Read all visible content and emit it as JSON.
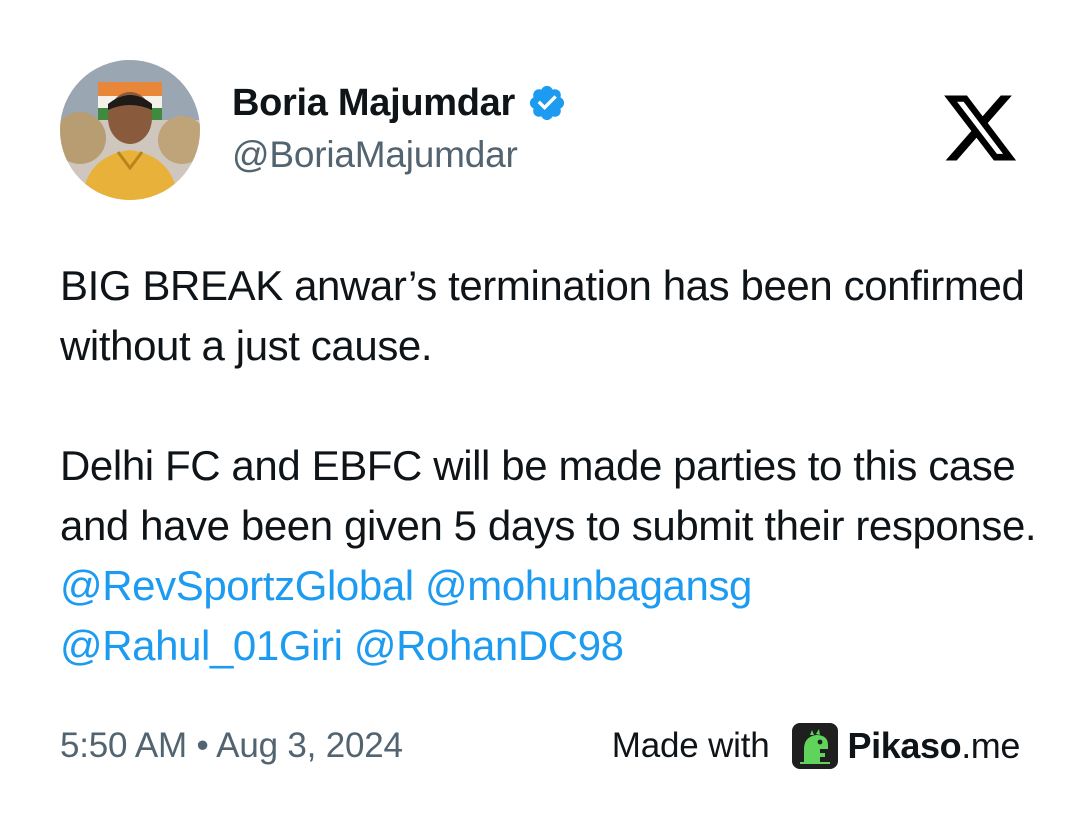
{
  "author": {
    "display_name": "Boria Majumdar",
    "handle": "@BoriaMajumdar",
    "verified": true
  },
  "tweet": {
    "paragraph_1": "BIG BREAK anwar’s termination has been confirmed without a just cause.",
    "paragraph_2_text": "Delhi FC and EBFC will be made parties to this case and have been given 5 days to submit their response. ",
    "mentions": [
      "@RevSportzGlobal",
      "@mohunbagansg",
      "@Rahul_01Giri",
      "@RohanDC98"
    ]
  },
  "footer": {
    "timestamp": "5:50 AM • Aug 3, 2024",
    "made_with_label": "Made with",
    "brand_name": "Pikaso",
    "brand_tld": ".me"
  },
  "icons": {
    "verified": "verified-badge-icon",
    "platform": "x-logo-icon",
    "brand": "pikaso-dinosaur-icon"
  },
  "colors": {
    "text": "#0f1419",
    "secondary_text": "#536471",
    "mention": "#1d9bf0",
    "verified": "#1d9bf0",
    "brand_icon_bg": "#1f1f1f",
    "brand_icon_fg": "#5fd35c"
  }
}
